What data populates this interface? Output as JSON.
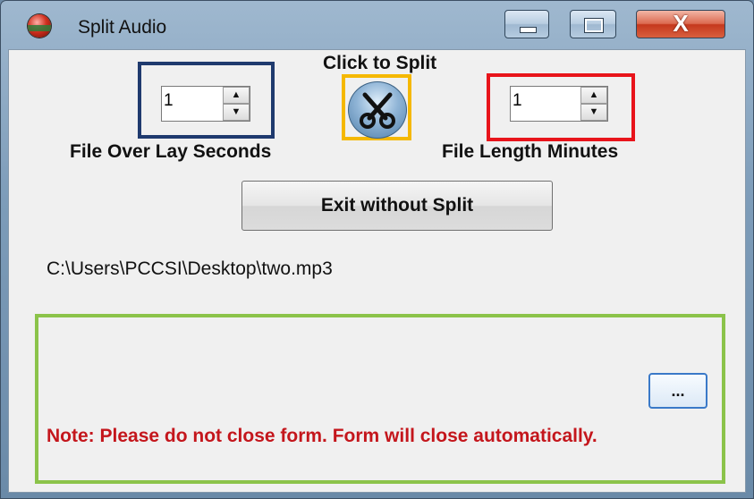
{
  "window": {
    "title": "Split Audio",
    "controls": {
      "minimize_icon": "minimize-icon",
      "maximize_icon": "maximize-icon",
      "close_glyph": "X"
    }
  },
  "split": {
    "caption": "Click to Split",
    "icon": "scissors-icon"
  },
  "overlay": {
    "value": "1",
    "label": "File Over Lay Seconds",
    "up_glyph": "▲",
    "down_glyph": "▼"
  },
  "length": {
    "value": "1",
    "label": "File Length Minutes",
    "up_glyph": "▲",
    "down_glyph": "▼"
  },
  "exit_button": {
    "label": "Exit without Split"
  },
  "file_path": "C:\\Users\\PCCSI\\Desktop\\two.mp3",
  "browse_button": {
    "label": "..."
  },
  "note": "Note: Please do not close form. Form will close automatically.",
  "highlight_colors": {
    "overlay": "#1f3a6e",
    "split": "#f5b800",
    "length": "#e8141b",
    "bottom_panel": "#8bc34a"
  }
}
